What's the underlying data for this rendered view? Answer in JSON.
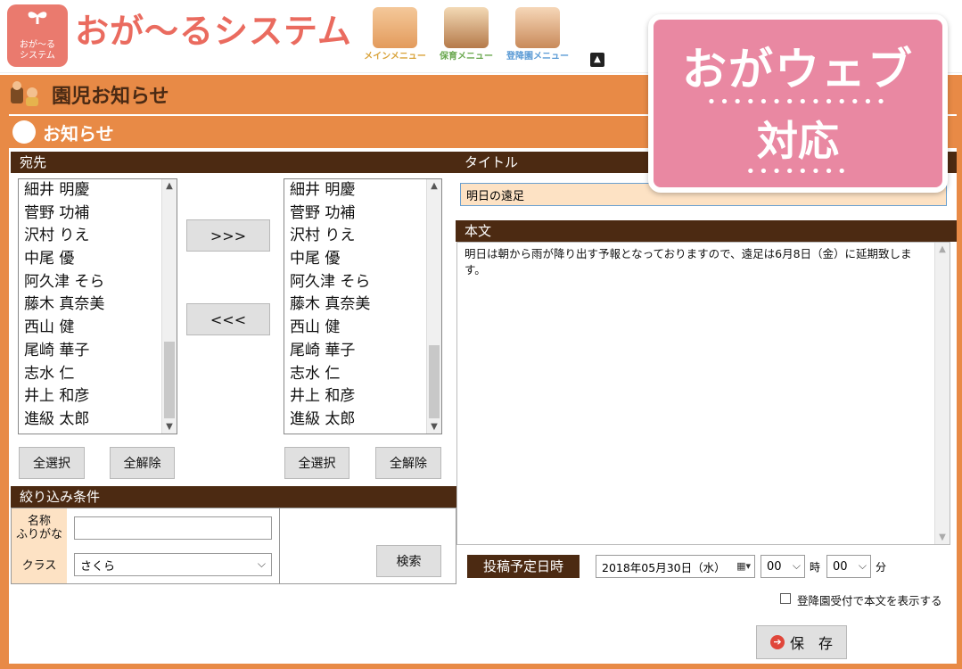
{
  "header": {
    "logo_text": "おが〜る\nシステム",
    "app_title": "おが〜るシステム",
    "menus": [
      {
        "label": "メインメニュー",
        "color": "#d9a33b"
      },
      {
        "label": "保育メニュー",
        "color": "#6aa84f"
      },
      {
        "label": "登降園メニュー",
        "color": "#5b9bd5"
      }
    ]
  },
  "page": {
    "title": "園児お知らせ"
  },
  "section": {
    "title": "お知らせ"
  },
  "left": {
    "recipients_header": "宛先",
    "list_left": [
      "細井 明慶",
      "菅野 功補",
      "沢村 りえ",
      "中尾 優",
      "阿久津 そら",
      "藤木 真奈美",
      "西山 健",
      "尾崎 華子",
      "志水 仁",
      "井上 和彦",
      "進級 太郎"
    ],
    "list_right": [
      "細井 明慶",
      "菅野 功補",
      "沢村 りえ",
      "中尾 優",
      "阿久津 そら",
      "藤木 真奈美",
      "西山 健",
      "尾崎 華子",
      "志水 仁",
      "井上 和彦",
      "進級 太郎"
    ],
    "move_right": ">>>",
    "move_left": "<<<",
    "select_all": "全選択",
    "deselect_all": "全解除",
    "filter_header": "絞り込み条件",
    "name_label": "名称\nふりがな",
    "name_value": "",
    "class_label": "クラス",
    "class_value": "さくら",
    "search": "検索"
  },
  "right": {
    "title_header": "タイトル",
    "title_value": "明日の遠足",
    "body_header": "本文",
    "body_value": "明日は朝から雨が降り出す予報となっておりますので、遠足は6月8日（金）に延期致します。",
    "schedule_label": "投稿予定日時",
    "date_value": "2018年05月30日（水）",
    "hour_value": "00",
    "hour_unit": "時",
    "minute_value": "00",
    "minute_unit": "分",
    "show_body_label": "登降園受付で本文を表示する",
    "save": "保　存"
  },
  "badge": {
    "line1": "おがウェブ",
    "line2": "対応"
  },
  "colors": {
    "accent": "#e88a46",
    "dark": "#4c2a12",
    "badge": "#e988a2",
    "label_bg": "#fde2c4"
  }
}
